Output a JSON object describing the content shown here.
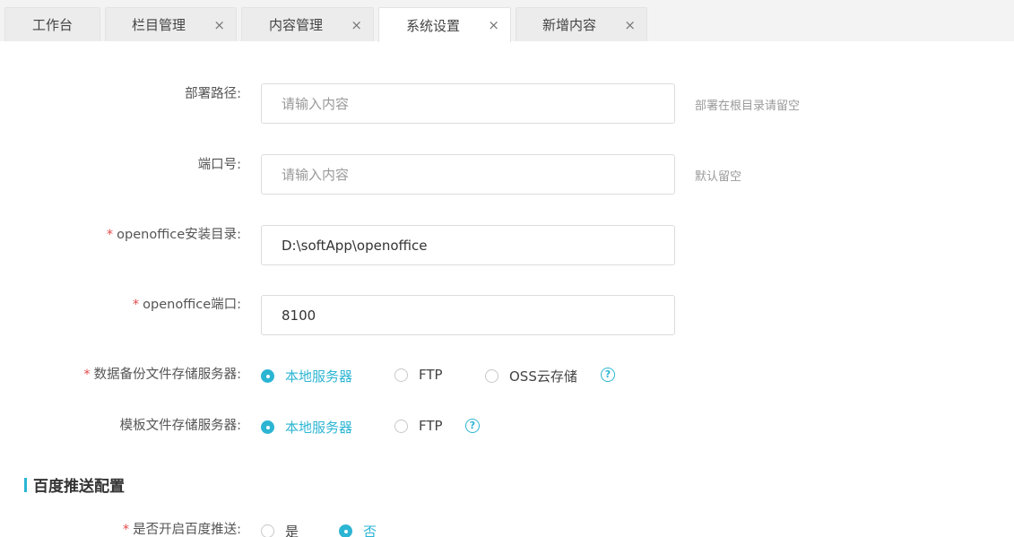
{
  "tabs": [
    {
      "label": "工作台",
      "closable": false,
      "active": false
    },
    {
      "label": "栏目管理",
      "closable": true,
      "active": false
    },
    {
      "label": "内容管理",
      "closable": true,
      "active": false
    },
    {
      "label": "系统设置",
      "closable": true,
      "active": true
    },
    {
      "label": "新增内容",
      "closable": true,
      "active": false
    }
  ],
  "close_glyph": "×",
  "form": {
    "deploy_path": {
      "label": "部署路径:",
      "placeholder": "请输入内容",
      "value": "",
      "hint": "部署在根目录请留空"
    },
    "port": {
      "label": "端口号:",
      "placeholder": "请输入内容",
      "value": "",
      "hint": "默认留空"
    },
    "openoffice_dir": {
      "required": "*",
      "label": "openoffice安装目录:",
      "value": "D:\\softApp\\openoffice"
    },
    "openoffice_port": {
      "required": "*",
      "label": "openoffice端口:",
      "value": "8100"
    },
    "backup_server": {
      "required": "*",
      "label": "数据备份文件存储服务器:",
      "options": [
        "本地服务器",
        "FTP",
        "OSS云存储"
      ],
      "selected": "本地服务器",
      "help": "?"
    },
    "template_server": {
      "label": "模板文件存储服务器:",
      "options": [
        "本地服务器",
        "FTP"
      ],
      "selected": "本地服务器",
      "help": "?"
    }
  },
  "baidu_section": {
    "title": "百度推送配置",
    "enable_push": {
      "required": "*",
      "label": "是否开启百度推送:",
      "options": [
        "是",
        "否"
      ],
      "selected": "否"
    }
  },
  "colors": {
    "accent": "#2cb5d3",
    "required": "#e64b4b"
  }
}
